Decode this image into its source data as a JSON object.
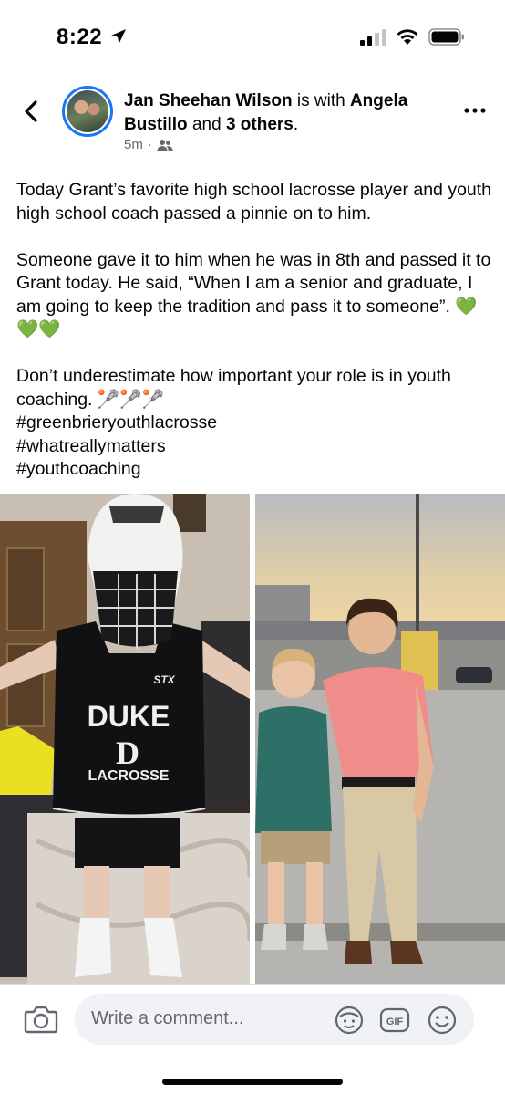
{
  "status_bar": {
    "time": "8:22"
  },
  "header": {
    "author": "Jan Sheehan Wilson",
    "with_text": " is with ",
    "tagged": "Angela Bustillo",
    "and_text": " and ",
    "others": "3 others",
    "period": ".",
    "timestamp": "5m",
    "separator": "·",
    "audience_icon": "friends-icon"
  },
  "post": {
    "paragraph_1": "Today Grant’s favorite high school lacrosse player and youth high school coach passed a pinnie on to him.",
    "paragraph_2": "Someone gave it to him when he was in 8th and passed it to Grant today. He said, “When I am a senior and graduate, I am going to keep the tradition and pass it to someone”. 💚💚💚",
    "paragraph_3_line_1": "Don’t underestimate how important your role is in youth coaching. 🥍🥍🥍",
    "hashtags": [
      "#greenbrieryouthlacrosse",
      "#whatreallymatters",
      "#youthcoaching"
    ]
  },
  "photos": {
    "left": {
      "helmet_brand": "STX",
      "jersey_line_1": "DUKE",
      "jersey_logo": "D",
      "jersey_line_2": "LACROSSE"
    }
  },
  "comment_bar": {
    "placeholder": "Write a comment...",
    "gif_label": "GIF",
    "accent": "#1877f2"
  }
}
